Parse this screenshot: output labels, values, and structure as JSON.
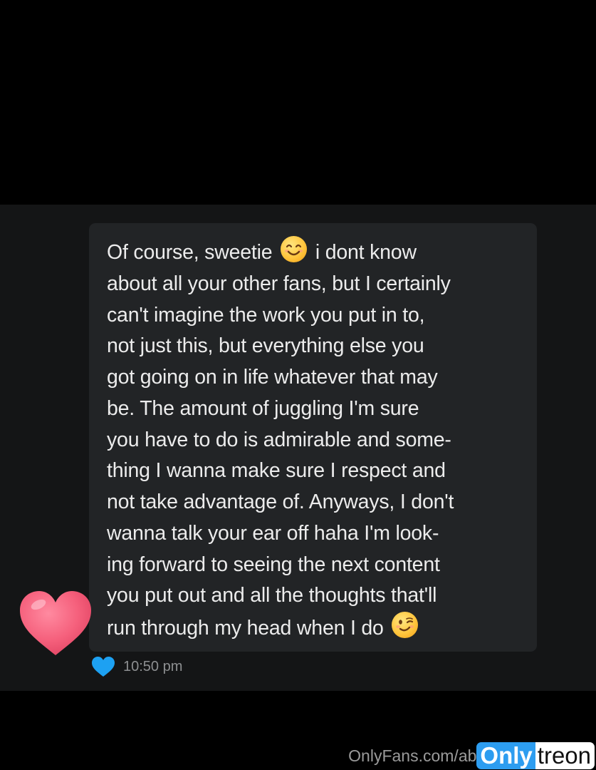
{
  "message": {
    "lines": [
      {
        "before": "Of course, sweetie ",
        "emoji": "smiling-face-emoji",
        "after": " i dont know"
      },
      {
        "text": "about all your other fans, but I certainly"
      },
      {
        "text": "can't imagine the work you put in to,"
      },
      {
        "text": "not just this, but everything else you"
      },
      {
        "text": "got going on in life whatever that may"
      },
      {
        "text": "be. The amount of juggling I'm sure"
      },
      {
        "text": "you have to do is admirable and some-"
      },
      {
        "text": "thing I wanna make sure I respect and"
      },
      {
        "text": "not take advantage of. Anyways, I don't"
      },
      {
        "text": "wanna talk your ear off haha I'm look-"
      },
      {
        "text": "ing forward to seeing the next content"
      },
      {
        "text": "you put out and all the thoughts that'll"
      },
      {
        "before": "run through my head when I do ",
        "emoji": "winking-face-emoji"
      }
    ]
  },
  "reaction": {
    "icon": "heart-icon",
    "color": "#f2607b"
  },
  "status": {
    "liked_icon": "heart-icon",
    "liked_color": "#1da1f2",
    "time": "10:50 pm"
  },
  "watermark": {
    "url": "OnlyFans.com/ab",
    "brand_left": "Only",
    "brand_right": "treon"
  },
  "colors": {
    "background": "#000000",
    "panel": "#141516",
    "bubble": "#222426",
    "text": "#ececec",
    "meta_text": "#8d8f91"
  }
}
